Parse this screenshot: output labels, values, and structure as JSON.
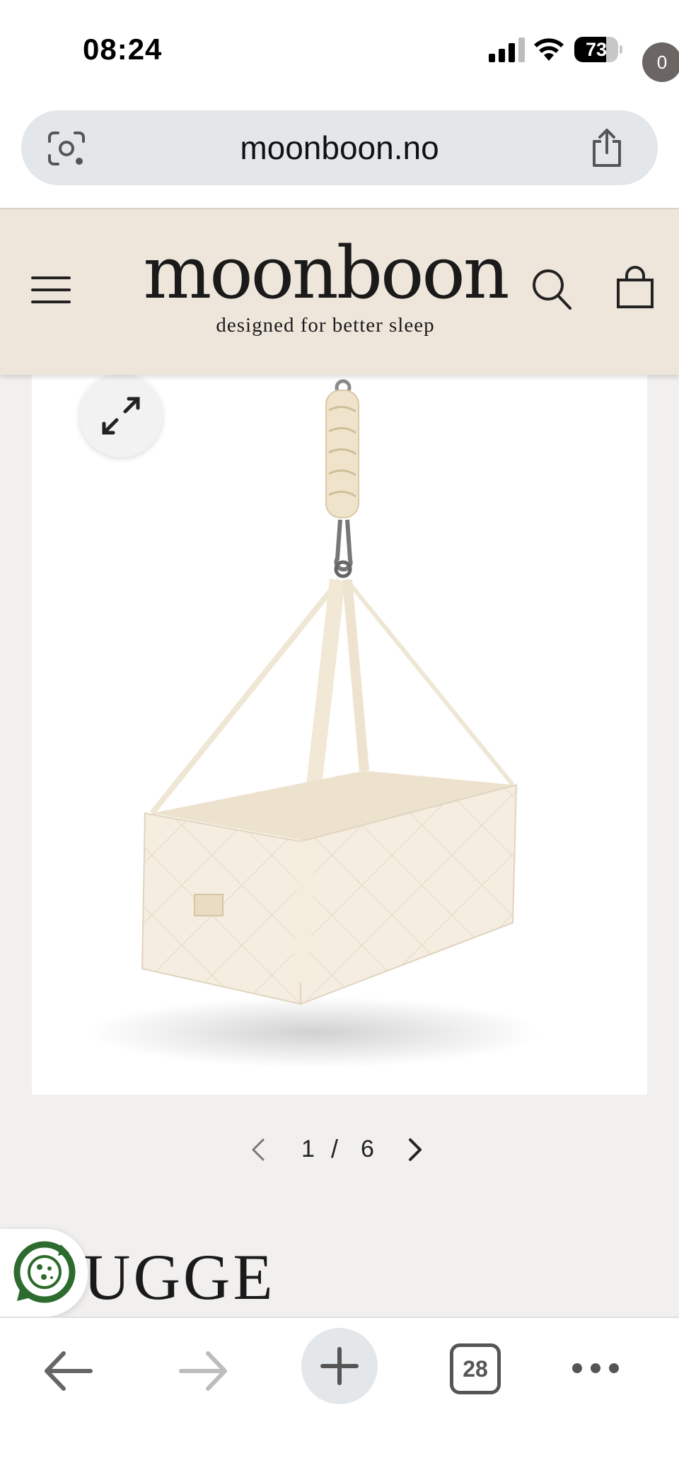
{
  "status_bar": {
    "time": "08:24",
    "battery_percent": "73",
    "battery_level": 0.73,
    "icons": [
      "signal-icon",
      "wifi-icon",
      "battery-icon"
    ]
  },
  "browser": {
    "url": "moonboon.no",
    "tab_count": "28",
    "icons": [
      "lens-icon",
      "share-icon",
      "back-icon",
      "forward-icon",
      "plus-icon",
      "more-icon"
    ]
  },
  "header": {
    "logo": "moonboon",
    "tagline": "designed for better sleep",
    "cart_count": "0",
    "background_color": "#eee6db"
  },
  "gallery": {
    "image_alt": "cradle-image",
    "current": "1",
    "separator": "/",
    "total": "6"
  },
  "product": {
    "title_visible": "UGGE"
  },
  "colors": {
    "page_bg": "#f1f0ee",
    "eco_green": "#2e6b2e",
    "fabric": "#f4ede0"
  }
}
